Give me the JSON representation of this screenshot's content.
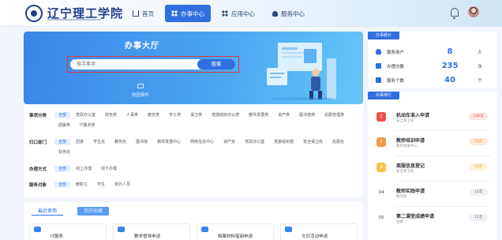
{
  "header": {
    "logo_text": "辽宁理工学院",
    "nav": [
      {
        "label": "首页",
        "icon": "home-icon"
      },
      {
        "label": "办事中心",
        "icon": "grid-icon",
        "active": true
      },
      {
        "label": "应用中心",
        "icon": "apps-icon"
      },
      {
        "label": "服务中心",
        "icon": "person-icon"
      }
    ]
  },
  "hero": {
    "title": "办事大厅",
    "search_placeholder": "搜寻事项",
    "search_button": "搜索",
    "recommend_label": "校园事件"
  },
  "filters": [
    {
      "label": "事项分类",
      "tags": [
        "全部",
        "党政办公室",
        "财务类",
        "人事类",
        "教务类",
        "学工类",
        "保卫类",
        "党建组织办公类",
        "教师发展类",
        "资产类",
        "图书馆类",
        "后勤管理类",
        "团委类",
        "IT服务类"
      ]
    },
    {
      "label": "归口部门",
      "tags": [
        "全部",
        "团委",
        "学生处",
        "教务处",
        "图书馆",
        "教师发展中心",
        "网络信息中心",
        "资产处",
        "党政办公室",
        "党委组织部",
        "安全保卫处",
        "后勤处",
        "财务处"
      ]
    },
    {
      "label": "办理方式",
      "tags": [
        "全部",
        "线上办理",
        "线下办理"
      ]
    },
    {
      "label": "服务对象",
      "tags": [
        "全部",
        "教职工",
        "学生",
        "校外人员"
      ]
    }
  ],
  "bottom": {
    "tabs": [
      "最近使用",
      "我的收藏"
    ],
    "cards": [
      "IT服务",
      "教学督导申请",
      "档案材料借阅申请",
      "文印活动申请"
    ]
  },
  "stats": {
    "header": "办事统计",
    "items": [
      {
        "label": "服务用户",
        "value": "8",
        "unit": "人"
      },
      {
        "label": "办理次数",
        "value": "235",
        "unit": "次"
      },
      {
        "label": "服务个数",
        "value": "40",
        "unit": "个"
      }
    ]
  },
  "todo": {
    "header": "办事排行",
    "items": [
      {
        "rank": "1",
        "title": "机动车准入申请",
        "sub": "安全保卫处",
        "count": "146次"
      },
      {
        "rank": "2",
        "title": "教师培训申请",
        "sub": "教师发展中心",
        "count": "25次"
      },
      {
        "rank": "3",
        "title": "商服信息登记",
        "sub": "安全保卫处",
        "count": "15次"
      },
      {
        "rank": "04",
        "title": "教师实践申请",
        "sub": "教务处",
        "count": "13次"
      },
      {
        "rank": "05",
        "title": "第二课堂成绩申请",
        "sub": "团委",
        "count": "12次"
      }
    ]
  },
  "colors": {
    "accent": "#2f6fe0",
    "highlight_outline": "#e3363b"
  }
}
